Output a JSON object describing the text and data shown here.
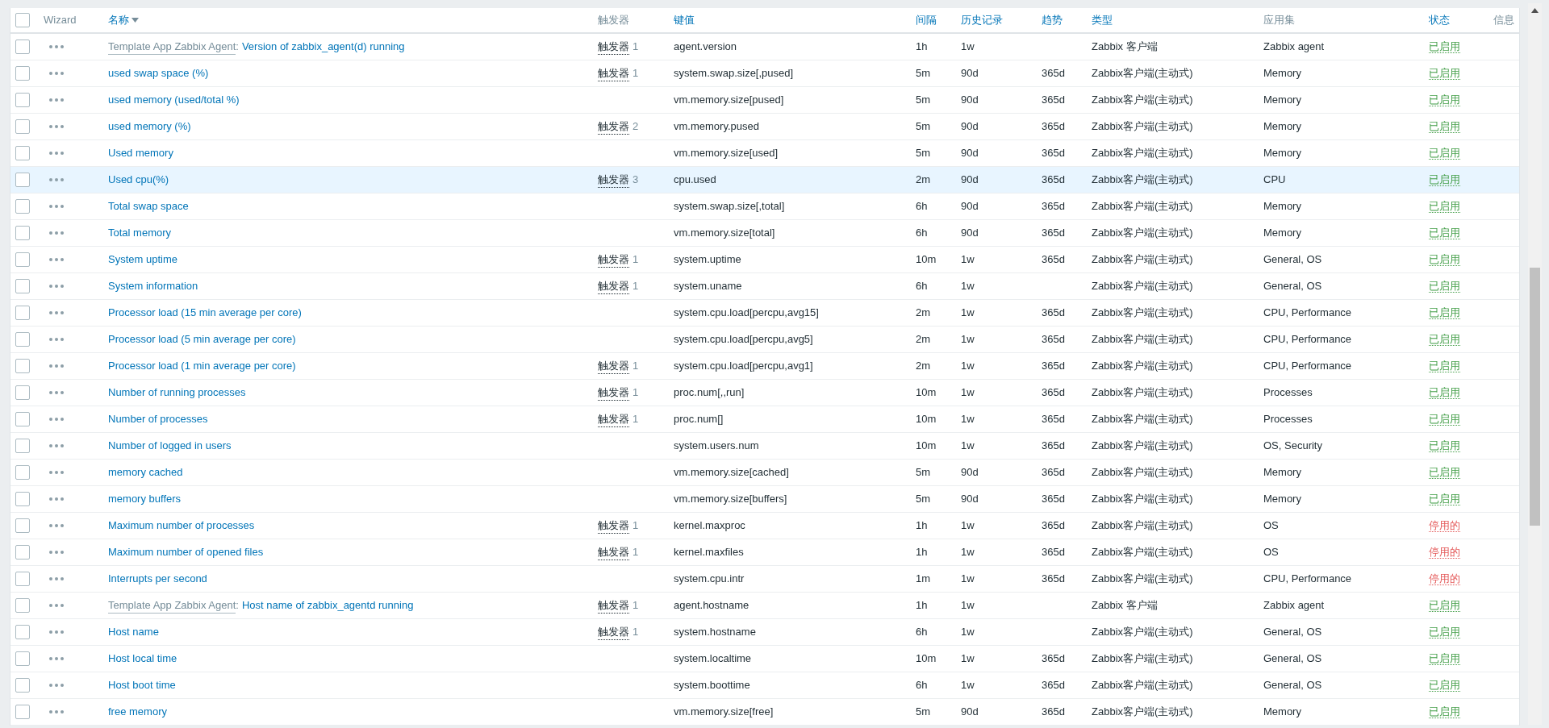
{
  "select_all_checked": false,
  "columns": [
    {
      "label": "Wizard",
      "sortable": false,
      "sorted": false
    },
    {
      "label": "名称",
      "sortable": true,
      "sorted": true
    },
    {
      "label": "触发器",
      "sortable": false,
      "sorted": false
    },
    {
      "label": "键值",
      "sortable": true,
      "sorted": false
    },
    {
      "label": "间隔",
      "sortable": true,
      "sorted": false
    },
    {
      "label": "历史记录",
      "sortable": true,
      "sorted": false
    },
    {
      "label": "趋势",
      "sortable": true,
      "sorted": false
    },
    {
      "label": "类型",
      "sortable": true,
      "sorted": false
    },
    {
      "label": "应用集",
      "sortable": false,
      "sorted": false
    },
    {
      "label": "状态",
      "sortable": true,
      "sorted": false
    },
    {
      "label": "信息",
      "sortable": false,
      "sorted": false
    }
  ],
  "rows": [
    {
      "template": "Template App Zabbix Agent",
      "separator": ":",
      "name": "Version of zabbix_agent(d) running",
      "trigger_label": "触发器",
      "trigger_count": "1",
      "key": "agent.version",
      "interval": "1h",
      "history": "1w",
      "type": "Zabbix 客户端",
      "apps": "Zabbix agent",
      "status": "已启用",
      "enabled": true,
      "hovered": false,
      "checked": false
    },
    {
      "name": "used swap space (%)",
      "trigger_label": "触发器",
      "trigger_count": "1",
      "key": "system.swap.size[,pused]",
      "interval": "5m",
      "history": "90d",
      "trend": "365d",
      "type": "Zabbix客户端(主动式)",
      "apps": "Memory",
      "status": "已启用",
      "enabled": true,
      "hovered": false,
      "checked": false
    },
    {
      "name": "used memory (used/total %)",
      "key": "vm.memory.size[pused]",
      "interval": "5m",
      "history": "90d",
      "trend": "365d",
      "type": "Zabbix客户端(主动式)",
      "apps": "Memory",
      "status": "已启用",
      "enabled": true,
      "hovered": false,
      "checked": false
    },
    {
      "name": "used memory (%)",
      "trigger_label": "触发器",
      "trigger_count": "2",
      "key": "vm.memory.pused",
      "interval": "5m",
      "history": "90d",
      "trend": "365d",
      "type": "Zabbix客户端(主动式)",
      "apps": "Memory",
      "status": "已启用",
      "enabled": true,
      "hovered": false,
      "checked": false
    },
    {
      "name": "Used memory",
      "key": "vm.memory.size[used]",
      "interval": "5m",
      "history": "90d",
      "trend": "365d",
      "type": "Zabbix客户端(主动式)",
      "apps": "Memory",
      "status": "已启用",
      "enabled": true,
      "hovered": false,
      "checked": false
    },
    {
      "name": "Used cpu(%)",
      "trigger_label": "触发器",
      "trigger_count": "3",
      "key": "cpu.used",
      "interval": "2m",
      "history": "90d",
      "trend": "365d",
      "type": "Zabbix客户端(主动式)",
      "apps": "CPU",
      "status": "已启用",
      "enabled": true,
      "hovered": true,
      "checked": false
    },
    {
      "name": "Total swap space",
      "key": "system.swap.size[,total]",
      "interval": "6h",
      "history": "90d",
      "trend": "365d",
      "type": "Zabbix客户端(主动式)",
      "apps": "Memory",
      "status": "已启用",
      "enabled": true,
      "hovered": false,
      "checked": false
    },
    {
      "name": "Total memory",
      "key": "vm.memory.size[total]",
      "interval": "6h",
      "history": "90d",
      "trend": "365d",
      "type": "Zabbix客户端(主动式)",
      "apps": "Memory",
      "status": "已启用",
      "enabled": true,
      "hovered": false,
      "checked": false
    },
    {
      "name": "System uptime",
      "trigger_label": "触发器",
      "trigger_count": "1",
      "key": "system.uptime",
      "interval": "10m",
      "history": "1w",
      "trend": "365d",
      "type": "Zabbix客户端(主动式)",
      "apps": "General, OS",
      "status": "已启用",
      "enabled": true,
      "hovered": false,
      "checked": false
    },
    {
      "name": "System information",
      "trigger_label": "触发器",
      "trigger_count": "1",
      "key": "system.uname",
      "interval": "6h",
      "history": "1w",
      "type": "Zabbix客户端(主动式)",
      "apps": "General, OS",
      "status": "已启用",
      "enabled": true,
      "hovered": false,
      "checked": false
    },
    {
      "name": "Processor load (15 min average per core)",
      "key": "system.cpu.load[percpu,avg15]",
      "interval": "2m",
      "history": "1w",
      "trend": "365d",
      "type": "Zabbix客户端(主动式)",
      "apps": "CPU, Performance",
      "status": "已启用",
      "enabled": true,
      "hovered": false,
      "checked": false
    },
    {
      "name": "Processor load (5 min average per core)",
      "key": "system.cpu.load[percpu,avg5]",
      "interval": "2m",
      "history": "1w",
      "trend": "365d",
      "type": "Zabbix客户端(主动式)",
      "apps": "CPU, Performance",
      "status": "已启用",
      "enabled": true,
      "hovered": false,
      "checked": false
    },
    {
      "name": "Processor load (1 min average per core)",
      "trigger_label": "触发器",
      "trigger_count": "1",
      "key": "system.cpu.load[percpu,avg1]",
      "interval": "2m",
      "history": "1w",
      "trend": "365d",
      "type": "Zabbix客户端(主动式)",
      "apps": "CPU, Performance",
      "status": "已启用",
      "enabled": true,
      "hovered": false,
      "checked": false
    },
    {
      "name": "Number of running processes",
      "trigger_label": "触发器",
      "trigger_count": "1",
      "key": "proc.num[,,run]",
      "interval": "10m",
      "history": "1w",
      "trend": "365d",
      "type": "Zabbix客户端(主动式)",
      "apps": "Processes",
      "status": "已启用",
      "enabled": true,
      "hovered": false,
      "checked": false
    },
    {
      "name": "Number of processes",
      "trigger_label": "触发器",
      "trigger_count": "1",
      "key": "proc.num[]",
      "interval": "10m",
      "history": "1w",
      "trend": "365d",
      "type": "Zabbix客户端(主动式)",
      "apps": "Processes",
      "status": "已启用",
      "enabled": true,
      "hovered": false,
      "checked": false
    },
    {
      "name": "Number of logged in users",
      "key": "system.users.num",
      "interval": "10m",
      "history": "1w",
      "trend": "365d",
      "type": "Zabbix客户端(主动式)",
      "apps": "OS, Security",
      "status": "已启用",
      "enabled": true,
      "hovered": false,
      "checked": false
    },
    {
      "name": "memory cached",
      "key": "vm.memory.size[cached]",
      "interval": "5m",
      "history": "90d",
      "trend": "365d",
      "type": "Zabbix客户端(主动式)",
      "apps": "Memory",
      "status": "已启用",
      "enabled": true,
      "hovered": false,
      "checked": false
    },
    {
      "name": "memory buffers",
      "key": "vm.memory.size[buffers]",
      "interval": "5m",
      "history": "90d",
      "trend": "365d",
      "type": "Zabbix客户端(主动式)",
      "apps": "Memory",
      "status": "已启用",
      "enabled": true,
      "hovered": false,
      "checked": false
    },
    {
      "name": "Maximum number of processes",
      "trigger_label": "触发器",
      "trigger_count": "1",
      "key": "kernel.maxproc",
      "interval": "1h",
      "history": "1w",
      "trend": "365d",
      "type": "Zabbix客户端(主动式)",
      "apps": "OS",
      "status": "停用的",
      "enabled": false,
      "hovered": false,
      "checked": false
    },
    {
      "name": "Maximum number of opened files",
      "trigger_label": "触发器",
      "trigger_count": "1",
      "key": "kernel.maxfiles",
      "interval": "1h",
      "history": "1w",
      "trend": "365d",
      "type": "Zabbix客户端(主动式)",
      "apps": "OS",
      "status": "停用的",
      "enabled": false,
      "hovered": false,
      "checked": false
    },
    {
      "name": "Interrupts per second",
      "key": "system.cpu.intr",
      "interval": "1m",
      "history": "1w",
      "trend": "365d",
      "type": "Zabbix客户端(主动式)",
      "apps": "CPU, Performance",
      "status": "停用的",
      "enabled": false,
      "hovered": false,
      "checked": false
    },
    {
      "template": "Template App Zabbix Agent",
      "separator": ":",
      "name": "Host name of zabbix_agentd running",
      "trigger_label": "触发器",
      "trigger_count": "1",
      "key": "agent.hostname",
      "interval": "1h",
      "history": "1w",
      "type": "Zabbix 客户端",
      "apps": "Zabbix agent",
      "status": "已启用",
      "enabled": true,
      "hovered": false,
      "checked": false
    },
    {
      "name": "Host name",
      "trigger_label": "触发器",
      "trigger_count": "1",
      "key": "system.hostname",
      "interval": "6h",
      "history": "1w",
      "type": "Zabbix客户端(主动式)",
      "apps": "General, OS",
      "status": "已启用",
      "enabled": true,
      "hovered": false,
      "checked": false
    },
    {
      "name": "Host local time",
      "key": "system.localtime",
      "interval": "10m",
      "history": "1w",
      "trend": "365d",
      "type": "Zabbix客户端(主动式)",
      "apps": "General, OS",
      "status": "已启用",
      "enabled": true,
      "hovered": false,
      "checked": false
    },
    {
      "name": "Host boot time",
      "key": "system.boottime",
      "interval": "6h",
      "history": "1w",
      "trend": "365d",
      "type": "Zabbix客户端(主动式)",
      "apps": "General, OS",
      "status": "已启用",
      "enabled": true,
      "hovered": false,
      "checked": false
    },
    {
      "name": "free memory",
      "key": "vm.memory.size[free]",
      "interval": "5m",
      "history": "90d",
      "trend": "365d",
      "type": "Zabbix客户端(主动式)",
      "apps": "Memory",
      "status": "已启用",
      "enabled": true,
      "hovered": false,
      "checked": false
    }
  ]
}
